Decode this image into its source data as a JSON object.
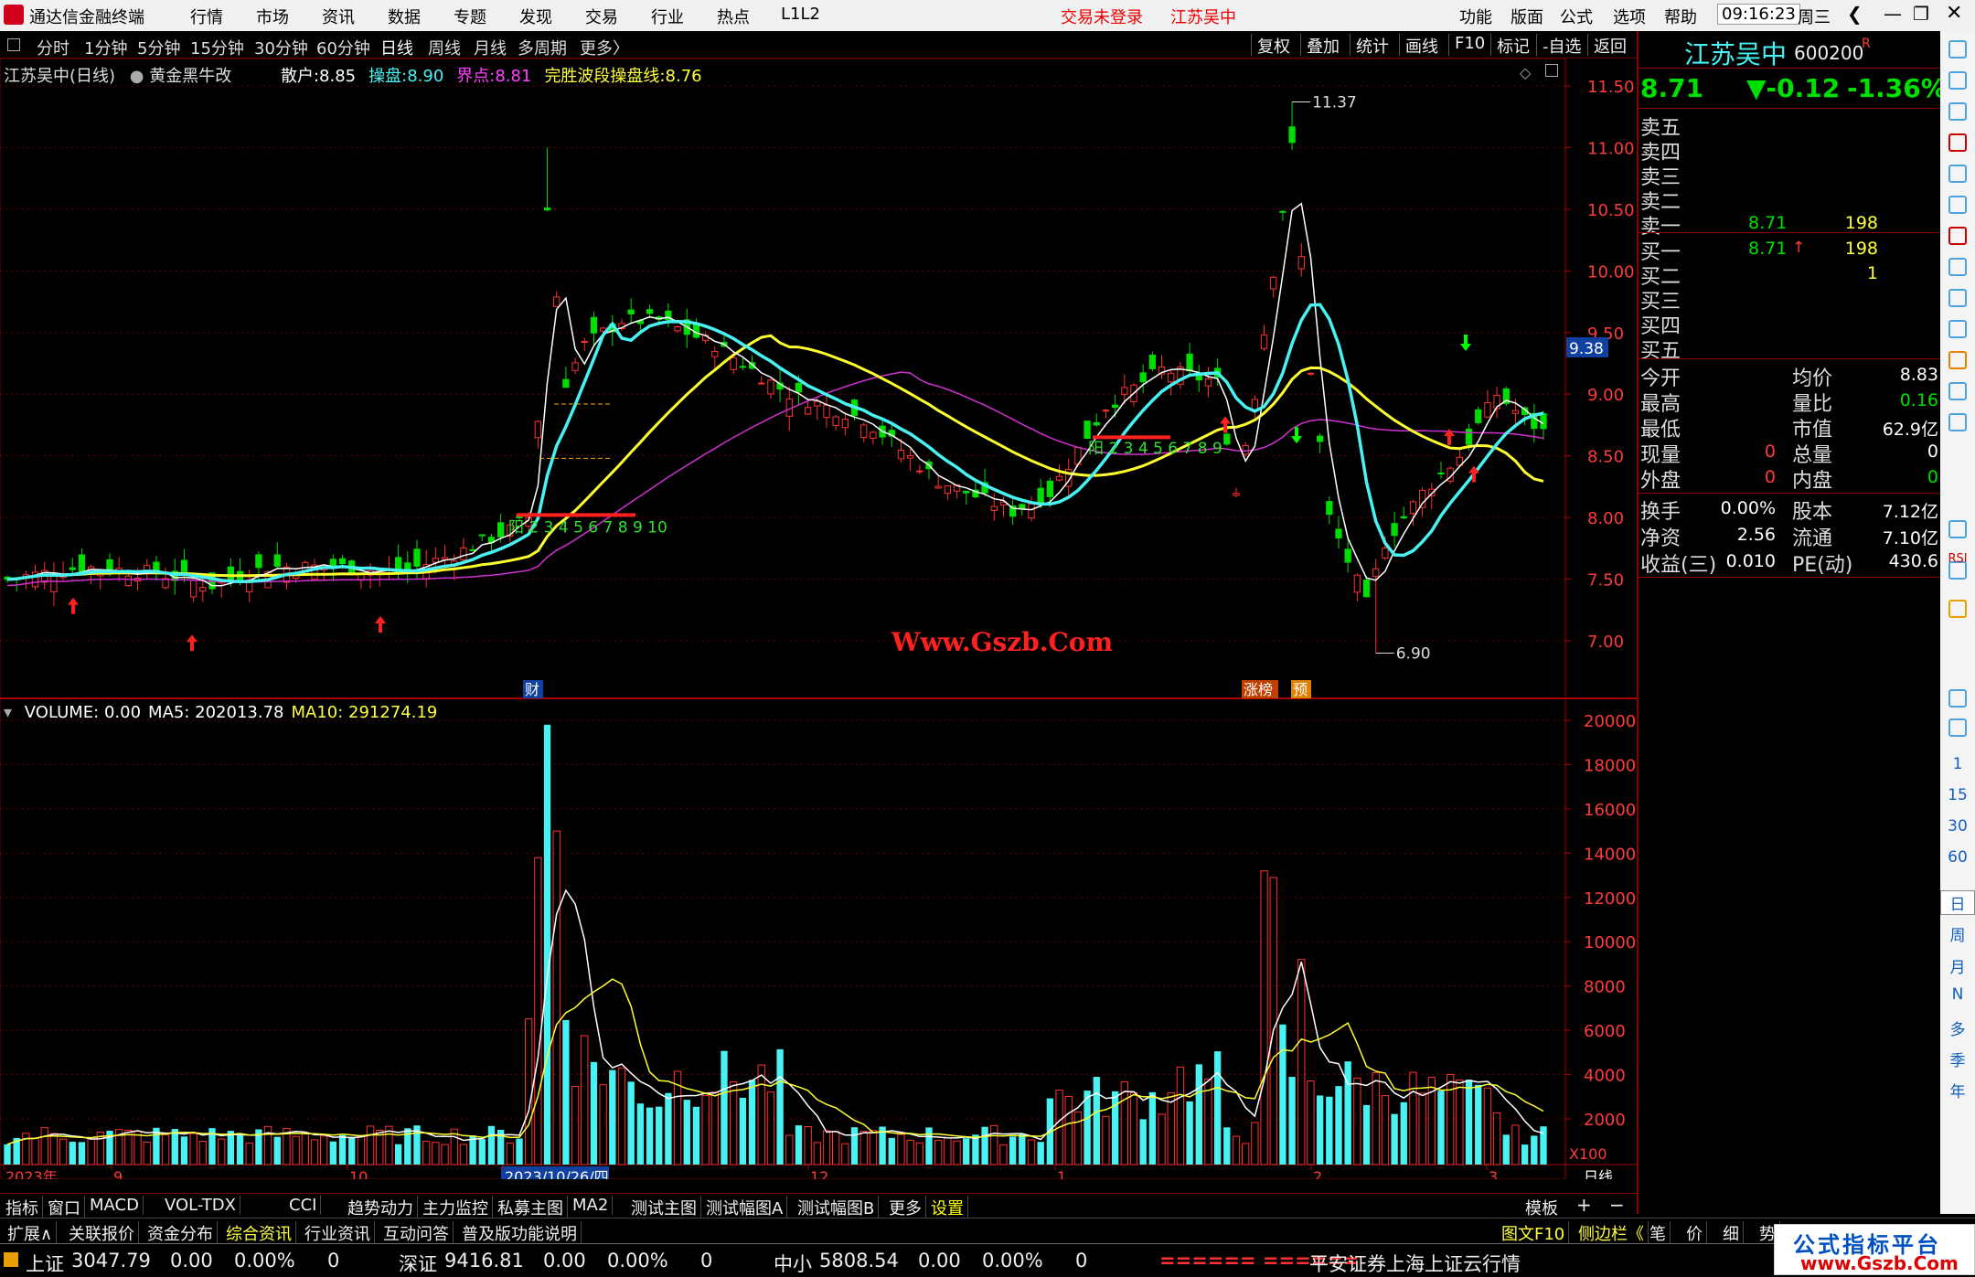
{
  "app": {
    "title": "通达信金融终端",
    "menus": [
      "行情",
      "市场",
      "资讯",
      "数据",
      "专题",
      "发现",
      "交易",
      "行业",
      "热点",
      "L1L2"
    ],
    "trade_status": "交易未登录",
    "stock_title": "江苏吴中",
    "right_menus": [
      "功能",
      "版面",
      "公式",
      "选项",
      "帮助"
    ],
    "time": "09:16:23",
    "weekday": "周三"
  },
  "period_bar": {
    "items": [
      "分时",
      "1分钟",
      "5分钟",
      "15分钟",
      "30分钟",
      "60分钟",
      "日线",
      "周线",
      "月线",
      "多周期",
      "更多〉"
    ],
    "active": "日线",
    "tools": [
      "复权",
      "叠加",
      "统计",
      "画线",
      "F10",
      "标记",
      "-自选",
      "返回"
    ]
  },
  "main_chart": {
    "stock_label": "江苏吴中(日线)",
    "indicator_name": "黄金黑牛改",
    "legend": [
      {
        "name": "散户:",
        "value": "8.85",
        "color": "#ffffff"
      },
      {
        "name": "操盘:",
        "value": "8.90",
        "color": "#49f2f2"
      },
      {
        "name": "界点:",
        "value": "8.81",
        "color": "#ff40ff"
      },
      {
        "name": "完胜波段操盘线:",
        "value": "8.76",
        "color": "#ffff40"
      }
    ],
    "price_axis": [
      "11.50",
      "11.00",
      "10.50",
      "10.00",
      "9.50",
      "9.00",
      "8.50",
      "8.00",
      "7.50",
      "7.00"
    ],
    "current_price_tag": "9.38",
    "high_label": "11.37",
    "low_label": "6.90",
    "watermark": "Www.Gszb.Com",
    "seq_label_1": "阳 2 3 4 5 6 7 8 9 10",
    "seq_label_2": "阳 2 3 4 5 6 7 8 9",
    "badge_cai": "财",
    "badge_zhang": "涨榜",
    "badge_yu": "预"
  },
  "volume_chart": {
    "legend": [
      {
        "name": "VOLUME:",
        "value": "0.00",
        "color": "#ffffff"
      },
      {
        "name": "MA5:",
        "value": "202013.78",
        "color": "#ffffff"
      },
      {
        "name": "MA10:",
        "value": "291274.19",
        "color": "#ffff40"
      }
    ],
    "axis": [
      "20000",
      "18000",
      "16000",
      "14000",
      "12000",
      "10000",
      "8000",
      "6000",
      "4000",
      "2000"
    ],
    "unit": "X100"
  },
  "date_axis": {
    "labels": [
      "2023年",
      "9",
      "10",
      "2023/10/26/四",
      "12",
      "1",
      "2",
      "3"
    ],
    "period": "日线"
  },
  "bottom_tabs": [
    "指标",
    "窗口",
    "MACD",
    "VOL-TDX",
    "CCI",
    "趋势动力",
    "主力监控",
    "私募主图",
    "MA2",
    "测试主图",
    "测试幅图A",
    "测试幅图B",
    "更多",
    "设置"
  ],
  "bottom_right": {
    "template": "模板",
    "plus": "+",
    "minus": "−"
  },
  "ext_bar": {
    "items": [
      "扩展∧",
      "关联报价",
      "资金分布",
      "综合资讯",
      "行业资讯",
      "互动问答",
      "普及版功能说明"
    ],
    "right_items": [
      "图文F10",
      "侧边栏《",
      "笔",
      "价",
      "细",
      "势"
    ]
  },
  "quote_panel": {
    "name": "江苏吴中",
    "code": "600200",
    "flag": "R",
    "price": "8.71",
    "change": "▼-0.12",
    "change_pct": "-1.36%",
    "asks": [
      {
        "label": "卖五",
        "price": "",
        "vol": ""
      },
      {
        "label": "卖四",
        "price": "",
        "vol": ""
      },
      {
        "label": "卖三",
        "price": "",
        "vol": ""
      },
      {
        "label": "卖二",
        "price": "",
        "vol": ""
      },
      {
        "label": "卖一",
        "price": "8.71",
        "vol": "198"
      }
    ],
    "bids": [
      {
        "label": "买一",
        "price": "8.71",
        "arrow": "↑",
        "vol": "198"
      },
      {
        "label": "买二",
        "price": "",
        "arrow": "",
        "vol": "1"
      },
      {
        "label": "买三",
        "price": "",
        "arrow": "",
        "vol": ""
      },
      {
        "label": "买四",
        "price": "",
        "arrow": "",
        "vol": ""
      },
      {
        "label": "买五",
        "price": "",
        "arrow": "",
        "vol": ""
      }
    ],
    "stats1": [
      {
        "l1": "今开",
        "v1": "",
        "l2": "均价",
        "v2": "8.83",
        "c2": "#ffffff"
      },
      {
        "l1": "最高",
        "v1": "",
        "l2": "量比",
        "v2": "0.16",
        "c2": "#00e000"
      },
      {
        "l1": "最低",
        "v1": "",
        "l2": "市值",
        "v2": "62.9亿",
        "c2": "#ffffff"
      },
      {
        "l1": "现量",
        "v1": "0",
        "l2": "总量",
        "v2": "0",
        "c2": "#ffffff"
      },
      {
        "l1": "外盘",
        "v1": "0",
        "l2": "内盘",
        "v2": "0",
        "c2": "#00e000"
      }
    ],
    "stats2": [
      {
        "l1": "换手",
        "v1": "0.00%",
        "l2": "股本",
        "v2": "7.12亿"
      },
      {
        "l1": "净资",
        "v1": "2.56",
        "l2": "流通",
        "v2": "7.10亿"
      },
      {
        "l1": "收益(三)",
        "v1": "0.010",
        "l2": "PE(动)",
        "v2": "430.6"
      }
    ]
  },
  "side_icons": {
    "labels": [
      "RSI",
      "1",
      "15",
      "30",
      "60",
      "日",
      "周",
      "月",
      "N",
      "多",
      "季",
      "年"
    ]
  },
  "status_bar": {
    "indices": [
      {
        "name": "上证",
        "value": "3047.79",
        "chg": "0.00",
        "pct": "0.00%",
        "vol": "0"
      },
      {
        "name": "深证",
        "value": "9416.81",
        "chg": "0.00",
        "pct": "0.00%",
        "vol": "0"
      },
      {
        "name": "中小",
        "value": "5808.54",
        "chg": "0.00",
        "pct": "0.00%",
        "vol": "0"
      }
    ],
    "marquee": "====== ======",
    "broker": "平安证券上海上证云行情",
    "brand_cn": "公式指标平台",
    "brand_url": "www.Gszb.Com"
  }
}
